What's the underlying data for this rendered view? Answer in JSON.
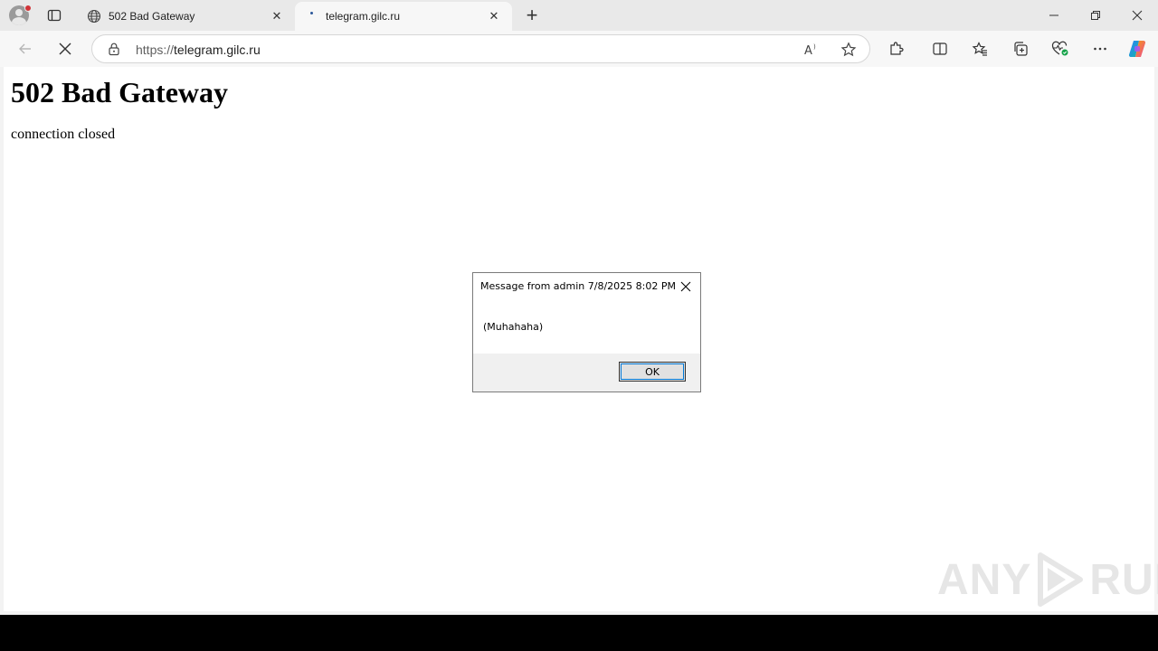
{
  "tabs": [
    {
      "title": "502 Bad Gateway",
      "close": "✕"
    },
    {
      "title": "telegram.gilc.ru",
      "close": "✕"
    }
  ],
  "new_tab": "+",
  "window_controls": {
    "minimize": "—",
    "restore": "❐",
    "close": "✕"
  },
  "address": {
    "protocol": "https://",
    "host": "telegram.gilc.ru"
  },
  "page": {
    "heading": "502 Bad Gateway",
    "message": "connection closed"
  },
  "dialog": {
    "title": "Message from admin 7/8/2025 8:02 PM",
    "message": "(Muhahaha)",
    "ok_label": "OK"
  },
  "watermark": {
    "left": "ANY",
    "right": "RUN"
  }
}
